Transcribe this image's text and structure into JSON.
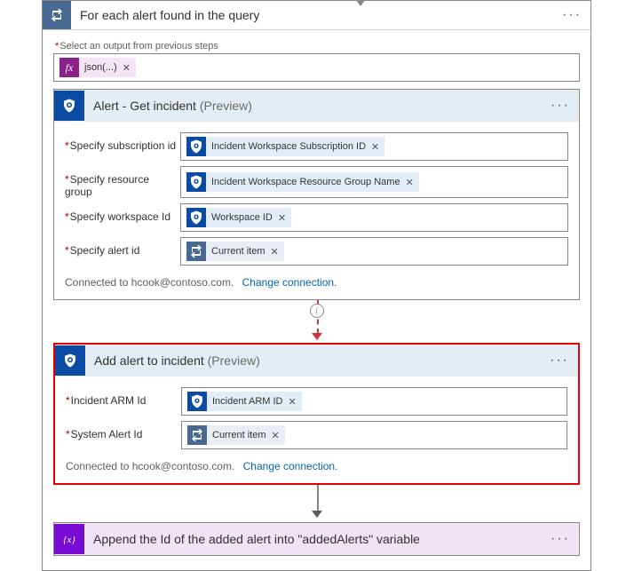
{
  "foreach": {
    "title": "For each alert found in the query",
    "output_label": "Select an output from previous steps",
    "token": {
      "label": "json(...)",
      "kind": "fx"
    }
  },
  "getIncident": {
    "title": "Alert - Get incident",
    "preview": "(Preview)",
    "fields": {
      "subscription": {
        "label": "Specify subscription id",
        "token": "Incident Workspace Subscription ID",
        "kind": "sentinel"
      },
      "resourcegroup": {
        "label": "Specify resource group",
        "token": "Incident Workspace Resource Group Name",
        "kind": "sentinel"
      },
      "workspace": {
        "label": "Specify workspace Id",
        "token": "Workspace ID",
        "kind": "sentinel"
      },
      "alert": {
        "label": "Specify alert id",
        "token": "Current item",
        "kind": "loop"
      }
    },
    "connected_to": "Connected to hcook@contoso.com.",
    "change": "Change connection."
  },
  "addAlert": {
    "title": "Add alert to incident",
    "preview": "(Preview)",
    "fields": {
      "arm": {
        "label": "Incident ARM Id",
        "token": "Incident ARM ID",
        "kind": "sentinel"
      },
      "sysalert": {
        "label": "System Alert Id",
        "token": "Current item",
        "kind": "loop"
      }
    },
    "connected_to": "Connected to hcook@contoso.com.",
    "change": "Change connection."
  },
  "appendVar": {
    "title": "Append the Id of the added alert into \"addedAlerts\" variable"
  },
  "glyphs": {
    "ellipsis": "···",
    "x": "✕",
    "i": "i"
  },
  "colors": {
    "red": "#e60000"
  }
}
